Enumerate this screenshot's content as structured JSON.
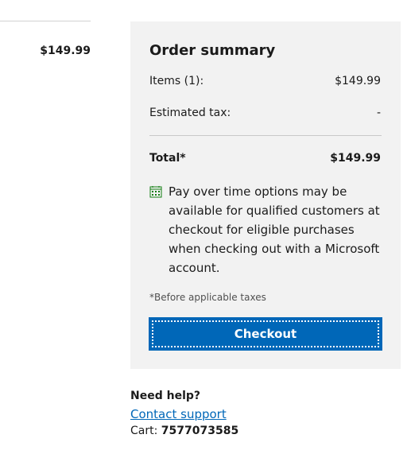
{
  "cart_item": {
    "price": "$149.99"
  },
  "order_summary": {
    "title": "Order summary",
    "items_label": "Items (1):",
    "items_value": "$149.99",
    "tax_label": "Estimated tax:",
    "tax_value": "-",
    "total_label": "Total*",
    "total_value": "$149.99",
    "pay_over_time_note": "Pay over time options may be available for qualified customers at checkout for eligible purchases when checking out with a Microsoft account.",
    "footnote": "*Before applicable taxes",
    "checkout_label": "Checkout"
  },
  "help": {
    "title": "Need help?",
    "contact_link": "Contact support",
    "cart_label": "Cart:",
    "cart_number": "7577073585"
  },
  "icons": {
    "calendar": "calendar-icon"
  },
  "colors": {
    "accent": "#0067b8",
    "panel_background": "#f2f2f2",
    "calendar_icon": "#107c10"
  }
}
